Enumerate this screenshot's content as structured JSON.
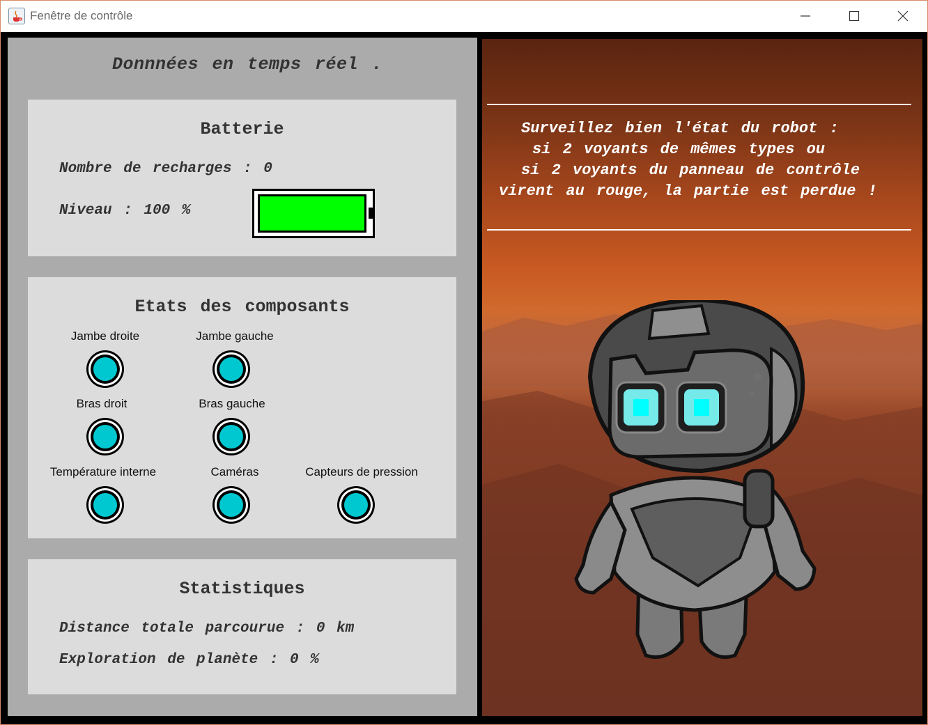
{
  "window": {
    "title": "Fenêtre de contrôle",
    "controls": [
      "minimize-icon",
      "maximize-icon",
      "close-icon"
    ]
  },
  "left_panel": {
    "heading": "Donnnées en temps réel .",
    "battery": {
      "title": "Batterie",
      "recharges_line": "Nombre de recharges : 0",
      "level_line": "Niveau : 100 %",
      "level_fraction": 1.0,
      "fill_color": "#00ff00"
    },
    "components": {
      "title": "Etats des composants",
      "items": [
        {
          "label": "Jambe droite",
          "status_color": "#00c8d0"
        },
        {
          "label": "Jambe gauche",
          "status_color": "#00c8d0"
        },
        {
          "label": "Bras droit",
          "status_color": "#00c8d0"
        },
        {
          "label": "Bras gauche",
          "status_color": "#00c8d0"
        },
        {
          "label": "Température interne",
          "status_color": "#00c8d0"
        },
        {
          "label": "Caméras",
          "status_color": "#00c8d0"
        },
        {
          "label": "Capteurs de pression",
          "status_color": "#00c8d0"
        }
      ]
    },
    "statistics": {
      "title": "Statistiques",
      "distance_line": "Distance totale parcourue : 0 km",
      "exploration_line": "Exploration de planète : 0 %"
    }
  },
  "right_panel": {
    "warning_lines": [
      "Surveillez bien l'état du robot :",
      "si 2 voyants de mêmes types ou",
      "si 2 voyants du panneau de contrôle",
      "virent au rouge, la partie est perdue !"
    ],
    "illustration": "robot-on-mars"
  }
}
